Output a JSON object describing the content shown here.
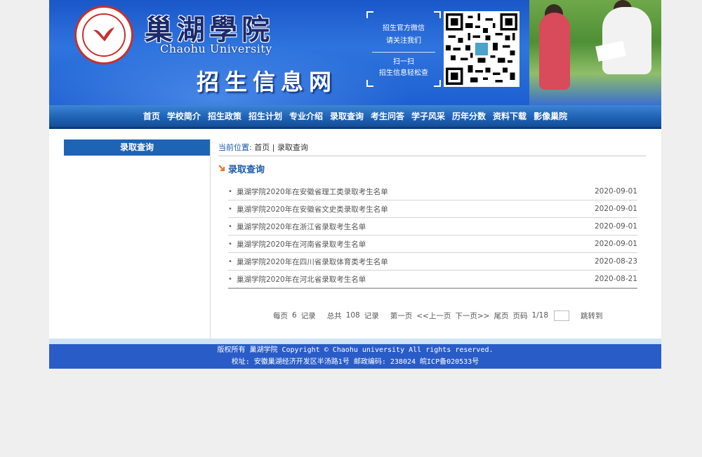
{
  "banner": {
    "university_cn": "巢湖學院",
    "university_en": "Chaohu University",
    "site_title": "招生信息网",
    "qr_line1": "招生官方微信",
    "qr_line2": "请关注我们",
    "qr_line3": "扫一扫",
    "qr_line4": "招生信息轻松查"
  },
  "nav": {
    "items": [
      {
        "label": "首页"
      },
      {
        "label": "学校简介"
      },
      {
        "label": "招生政策"
      },
      {
        "label": "招生计划"
      },
      {
        "label": "专业介绍"
      },
      {
        "label": "录取查询"
      },
      {
        "label": "考生问答"
      },
      {
        "label": "学子风采"
      },
      {
        "label": "历年分数"
      },
      {
        "label": "资料下载"
      },
      {
        "label": "影像巢院"
      }
    ]
  },
  "sidebar": {
    "title": "录取查询"
  },
  "breadcrumb": {
    "label": "当前位置:",
    "home": "首页",
    "sep": "|",
    "current": "录取查询"
  },
  "section": {
    "title": "录取查询"
  },
  "list": {
    "bullet": "•",
    "items": [
      {
        "title": "巢湖学院2020年在安徽省理工类录取考生名单",
        "date": "2020-09-01"
      },
      {
        "title": "巢湖学院2020年在安徽省文史类录取考生名单",
        "date": "2020-09-01"
      },
      {
        "title": "巢湖学院2020年在浙江省录取考生名单",
        "date": "2020-09-01"
      },
      {
        "title": "巢湖学院2020年在河南省录取考生名单",
        "date": "2020-09-01"
      },
      {
        "title": "巢湖学院2020年在四川省录取体育类考生名单",
        "date": "2020-08-23"
      },
      {
        "title": "巢湖学院2020年在河北省录取考生名单",
        "date": "2020-08-21"
      }
    ]
  },
  "pager": {
    "per_page_label": "每页",
    "per_page": "6",
    "records_label": "记录",
    "total_label": "总共",
    "total": "108",
    "records_label2": "记录",
    "first": "第一页",
    "prev": "<<上一页",
    "next": "下一页>>",
    "last": "尾页",
    "page_label": "页码",
    "page_info": "1/18",
    "jump_value": "",
    "jump": "跳转到"
  },
  "footer": {
    "line1": "版权所有 巢湖学院 Copyright © Chaohu university All rights reserved.",
    "line2": "校址: 安徽巢湖经济开发区半汤路1号 邮政编码: 238024 皖ICP备020533号"
  },
  "colors": {
    "brand_blue": "#1e64b4",
    "nav_blue": "#1f63b5",
    "footer_blue": "#2a5cc7",
    "link_blue": "#1e5aa8",
    "accent_orange": "#e8782a"
  }
}
